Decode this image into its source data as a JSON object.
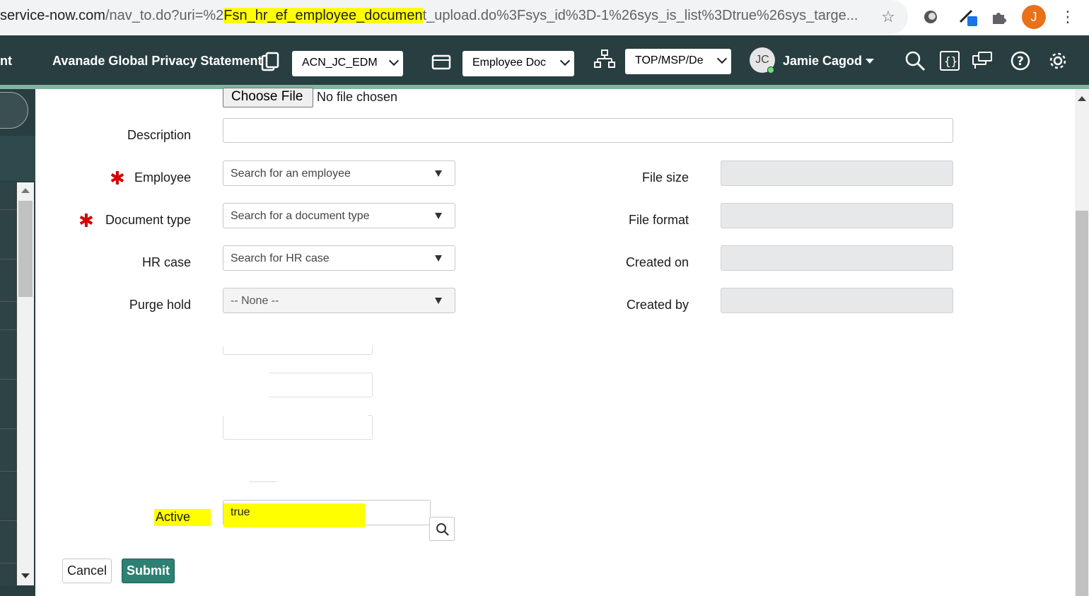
{
  "browser": {
    "url_prefix": "service-now.com",
    "url_part1": "/nav_to.do?uri=%2",
    "url_highlight": "Fsn_hr_ef_employee_documen",
    "url_part2": "t_upload.do%3Fsys_id%3D-1%26sys_is_list%3Dtrue%26sys_targe...",
    "profile_initial": "J"
  },
  "header": {
    "left_cut": "nt",
    "title": "Avanade Global Privacy Statement",
    "select1": "ACN_JC_EDM",
    "select2": "Employee Doc",
    "select3": "TOP/MSP/De",
    "avatar_initials": "JC",
    "user_name": "Jamie Cagod"
  },
  "form": {
    "choose_file_label": "Choose File",
    "no_file_label": "No file chosen",
    "description_label": "Description",
    "description_value": "",
    "employee_label": "Employee",
    "employee_placeholder": "Search for an employee",
    "document_type_label": "Document type",
    "document_type_placeholder": "Search for a document type",
    "hr_case_label": "HR case",
    "hr_case_placeholder": "Search for HR case",
    "purge_hold_label": "Purge hold",
    "purge_hold_value": "-- None --",
    "file_size_label": "File size",
    "file_format_label": "File format",
    "created_on_label": "Created on",
    "created_by_label": "Created by",
    "active_label": "Active",
    "active_value": "true",
    "cancel_label": "Cancel",
    "submit_label": "Submit"
  },
  "colors": {
    "header_bg": "#293e40",
    "accent": "#81b5a1",
    "submit_bg": "#2d8073",
    "highlight": "#ffff00",
    "required": "#d40000"
  }
}
